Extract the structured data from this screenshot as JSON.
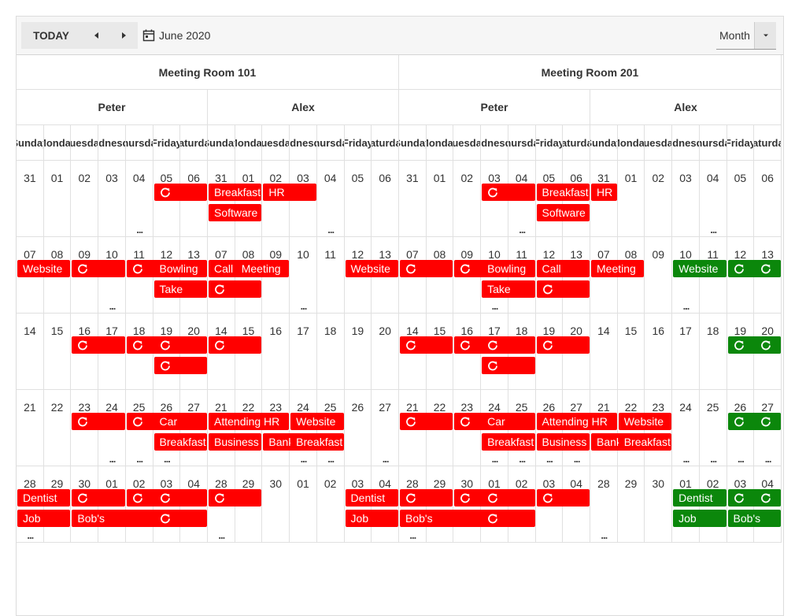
{
  "toolbar": {
    "today_label": "TODAY",
    "date_label": "June 2020",
    "view_label": "Month",
    "prev_icon": "triangle-left",
    "next_icon": "triangle-right",
    "calendar_icon": "calendar",
    "dropdown_icon": "triangle-down"
  },
  "rooms": [
    "Meeting Room 101",
    "Meeting Room 201"
  ],
  "employees": [
    "Peter",
    "Alex"
  ],
  "day_names": [
    "Sunday",
    "Monday",
    "Tuesday",
    "Wednesday",
    "Thursday",
    "Friday",
    "Saturday"
  ],
  "weeks": [
    [
      "31",
      "01",
      "02",
      "03",
      "04",
      "05",
      "06"
    ],
    [
      "07",
      "08",
      "09",
      "10",
      "11",
      "12",
      "13"
    ],
    [
      "14",
      "15",
      "16",
      "17",
      "18",
      "19",
      "20"
    ],
    [
      "21",
      "22",
      "23",
      "24",
      "25",
      "26",
      "27"
    ],
    [
      "28",
      "29",
      "30",
      "01",
      "02",
      "03",
      "04"
    ]
  ],
  "group_weeks": [
    [
      "31",
      "01",
      "02",
      "03",
      "04",
      "05",
      "06"
    ],
    [
      "07",
      "08",
      "09",
      "10",
      "11",
      "12",
      "13"
    ],
    [
      "14",
      "15",
      "16",
      "17",
      "18",
      "19",
      "20"
    ],
    [
      "21",
      "22",
      "23",
      "24",
      "25",
      "26",
      "27"
    ],
    [
      "28",
      "29",
      "30",
      "01",
      "02",
      "03",
      "04"
    ]
  ],
  "colors": {
    "red": "#ff0000",
    "green": "#0b870b"
  },
  "recurring_icon": "refresh-icon",
  "more_label": "...",
  "events": [
    {
      "g": 0,
      "w": 0,
      "s": 5,
      "span": 2,
      "r": 0,
      "text": "",
      "recurring": true,
      "color": "red"
    },
    {
      "g": 1,
      "w": 0,
      "s": 0,
      "span": 2,
      "r": 0,
      "text": "Breakfast",
      "recurring": false,
      "color": "red"
    },
    {
      "g": 1,
      "w": 0,
      "s": 2,
      "span": 2,
      "r": 0,
      "text": "HR",
      "recurring": false,
      "color": "red"
    },
    {
      "g": 1,
      "w": 0,
      "s": 0,
      "span": 2,
      "r": 1,
      "text": "Software",
      "recurring": false,
      "color": "red"
    },
    {
      "g": 2,
      "w": 0,
      "s": 3,
      "span": 2,
      "r": 0,
      "text": "",
      "recurring": true,
      "color": "red"
    },
    {
      "g": 2,
      "w": 0,
      "s": 5,
      "span": 2,
      "r": 0,
      "text": "Breakfast",
      "recurring": false,
      "color": "red"
    },
    {
      "g": 2,
      "w": 0,
      "s": 5,
      "span": 2,
      "r": 1,
      "text": "Software",
      "recurring": false,
      "color": "red"
    },
    {
      "g": 3,
      "w": 0,
      "s": 0,
      "span": 1,
      "r": 0,
      "text": "HR",
      "recurring": false,
      "color": "red"
    },
    {
      "g": 0,
      "w": 1,
      "s": 0,
      "span": 2,
      "r": 0,
      "text": "Website",
      "recurring": false,
      "color": "red"
    },
    {
      "g": 0,
      "w": 1,
      "s": 2,
      "span": 2,
      "r": 0,
      "text": "",
      "recurring": true,
      "color": "red"
    },
    {
      "g": 0,
      "w": 1,
      "s": 4,
      "span": 2,
      "r": 0,
      "text": "",
      "recurring": true,
      "color": "red"
    },
    {
      "g": 0,
      "w": 1,
      "s": 5,
      "span": 2,
      "r": 0,
      "text": "Bowling",
      "recurring": false,
      "color": "red"
    },
    {
      "g": 0,
      "w": 1,
      "s": 5,
      "span": 2,
      "r": 1,
      "text": "Take",
      "recurring": false,
      "color": "red"
    },
    {
      "g": 1,
      "w": 1,
      "s": 0,
      "span": 2,
      "r": 0,
      "text": "Call",
      "recurring": false,
      "color": "red"
    },
    {
      "g": 1,
      "w": 1,
      "s": 0,
      "span": 2,
      "r": 1,
      "text": "",
      "recurring": true,
      "color": "red"
    },
    {
      "g": 1,
      "w": 1,
      "s": 1,
      "span": 2,
      "r": 0,
      "text": "Meeting",
      "recurring": false,
      "color": "red"
    },
    {
      "g": 1,
      "w": 1,
      "s": 5,
      "span": 2,
      "r": 0,
      "text": "Website",
      "recurring": false,
      "color": "red"
    },
    {
      "g": 2,
      "w": 1,
      "s": 0,
      "span": 2,
      "r": 0,
      "text": "",
      "recurring": true,
      "color": "red"
    },
    {
      "g": 2,
      "w": 1,
      "s": 2,
      "span": 2,
      "r": 0,
      "text": "",
      "recurring": true,
      "color": "red"
    },
    {
      "g": 2,
      "w": 1,
      "s": 3,
      "span": 2,
      "r": 0,
      "text": "Bowling",
      "recurring": false,
      "color": "red"
    },
    {
      "g": 2,
      "w": 1,
      "s": 3,
      "span": 2,
      "r": 1,
      "text": "Take",
      "recurring": false,
      "color": "red"
    },
    {
      "g": 2,
      "w": 1,
      "s": 5,
      "span": 2,
      "r": 0,
      "text": "Call",
      "recurring": false,
      "color": "red"
    },
    {
      "g": 2,
      "w": 1,
      "s": 5,
      "span": 2,
      "r": 1,
      "text": "",
      "recurring": true,
      "color": "red"
    },
    {
      "g": 3,
      "w": 1,
      "s": 0,
      "span": 2,
      "r": 0,
      "text": "Meeting",
      "recurring": false,
      "color": "red"
    },
    {
      "g": 3,
      "w": 1,
      "s": 3,
      "span": 2,
      "r": 0,
      "text": "Website",
      "recurring": false,
      "color": "green"
    },
    {
      "g": 3,
      "w": 1,
      "s": 5,
      "span": 2,
      "r": 0,
      "text": "",
      "recurring": true,
      "color": "green"
    },
    {
      "g": 3,
      "w": 1,
      "s": 6,
      "span": 1,
      "r": 0,
      "text": "",
      "recurring": true,
      "color": "green"
    },
    {
      "g": 0,
      "w": 2,
      "s": 2,
      "span": 2,
      "r": 0,
      "text": "",
      "recurring": true,
      "color": "red"
    },
    {
      "g": 0,
      "w": 2,
      "s": 4,
      "span": 2,
      "r": 0,
      "text": "",
      "recurring": true,
      "color": "red"
    },
    {
      "g": 0,
      "w": 2,
      "s": 5,
      "span": 2,
      "r": 0,
      "text": "",
      "recurring": true,
      "color": "red"
    },
    {
      "g": 0,
      "w": 2,
      "s": 5,
      "span": 2,
      "r": 1,
      "text": "",
      "recurring": true,
      "color": "red"
    },
    {
      "g": 1,
      "w": 2,
      "s": 0,
      "span": 2,
      "r": 0,
      "text": "",
      "recurring": true,
      "color": "red"
    },
    {
      "g": 2,
      "w": 2,
      "s": 0,
      "span": 2,
      "r": 0,
      "text": "",
      "recurring": true,
      "color": "red"
    },
    {
      "g": 2,
      "w": 2,
      "s": 2,
      "span": 2,
      "r": 0,
      "text": "",
      "recurring": true,
      "color": "red"
    },
    {
      "g": 2,
      "w": 2,
      "s": 3,
      "span": 2,
      "r": 0,
      "text": "",
      "recurring": true,
      "color": "red"
    },
    {
      "g": 2,
      "w": 2,
      "s": 3,
      "span": 2,
      "r": 1,
      "text": "",
      "recurring": true,
      "color": "red"
    },
    {
      "g": 2,
      "w": 2,
      "s": 5,
      "span": 2,
      "r": 0,
      "text": "",
      "recurring": true,
      "color": "red"
    },
    {
      "g": 3,
      "w": 2,
      "s": 5,
      "span": 2,
      "r": 0,
      "text": "",
      "recurring": true,
      "color": "green"
    },
    {
      "g": 3,
      "w": 2,
      "s": 6,
      "span": 1,
      "r": 0,
      "text": "",
      "recurring": true,
      "color": "green"
    },
    {
      "g": 0,
      "w": 3,
      "s": 2,
      "span": 2,
      "r": 0,
      "text": "",
      "recurring": true,
      "color": "red"
    },
    {
      "g": 0,
      "w": 3,
      "s": 4,
      "span": 2,
      "r": 0,
      "text": "",
      "recurring": true,
      "color": "red"
    },
    {
      "g": 0,
      "w": 3,
      "s": 5,
      "span": 2,
      "r": 0,
      "text": "Car",
      "recurring": false,
      "color": "red"
    },
    {
      "g": 0,
      "w": 3,
      "s": 5,
      "span": 2,
      "r": 1,
      "text": "Breakfast",
      "recurring": false,
      "color": "red"
    },
    {
      "g": 1,
      "w": 3,
      "s": 0,
      "span": 3,
      "r": 0,
      "text": "Attending HR",
      "recurring": false,
      "color": "red"
    },
    {
      "g": 1,
      "w": 3,
      "s": 0,
      "span": 2,
      "r": 1,
      "text": "Business",
      "recurring": false,
      "color": "red"
    },
    {
      "g": 1,
      "w": 3,
      "s": 2,
      "span": 2,
      "r": 1,
      "text": "Banking",
      "recurring": false,
      "color": "red"
    },
    {
      "g": 1,
      "w": 3,
      "s": 3,
      "span": 2,
      "r": 0,
      "text": "Website",
      "recurring": false,
      "color": "red"
    },
    {
      "g": 1,
      "w": 3,
      "s": 3,
      "span": 2,
      "r": 1,
      "text": "Breakfast",
      "recurring": false,
      "color": "red"
    },
    {
      "g": 2,
      "w": 3,
      "s": 0,
      "span": 2,
      "r": 0,
      "text": "",
      "recurring": true,
      "color": "red"
    },
    {
      "g": 2,
      "w": 3,
      "s": 2,
      "span": 2,
      "r": 0,
      "text": "",
      "recurring": true,
      "color": "red"
    },
    {
      "g": 2,
      "w": 3,
      "s": 3,
      "span": 2,
      "r": 0,
      "text": "Car",
      "recurring": false,
      "color": "red"
    },
    {
      "g": 2,
      "w": 3,
      "s": 3,
      "span": 2,
      "r": 1,
      "text": "Breakfast",
      "recurring": false,
      "color": "red"
    },
    {
      "g": 2,
      "w": 3,
      "s": 5,
      "span": 3,
      "r": 0,
      "text": "Attending HR",
      "recurring": false,
      "color": "red"
    },
    {
      "g": 2,
      "w": 3,
      "s": 5,
      "span": 2,
      "r": 1,
      "text": "Business",
      "recurring": false,
      "color": "red"
    },
    {
      "g": 3,
      "w": 3,
      "s": 0,
      "span": 2,
      "r": 1,
      "text": "Banking",
      "recurring": false,
      "color": "red"
    },
    {
      "g": 3,
      "w": 3,
      "s": 1,
      "span": 2,
      "r": 0,
      "text": "Website",
      "recurring": false,
      "color": "red"
    },
    {
      "g": 3,
      "w": 3,
      "s": 1,
      "span": 2,
      "r": 1,
      "text": "Breakfast",
      "recurring": false,
      "color": "red"
    },
    {
      "g": 3,
      "w": 3,
      "s": 5,
      "span": 2,
      "r": 0,
      "text": "",
      "recurring": true,
      "color": "green"
    },
    {
      "g": 3,
      "w": 3,
      "s": 6,
      "span": 1,
      "r": 0,
      "text": "",
      "recurring": true,
      "color": "green"
    },
    {
      "g": 0,
      "w": 4,
      "s": 0,
      "span": 2,
      "r": 0,
      "text": "Dentist",
      "recurring": false,
      "color": "red"
    },
    {
      "g": 0,
      "w": 4,
      "s": 0,
      "span": 2,
      "r": 1,
      "text": "Job",
      "recurring": false,
      "color": "red"
    },
    {
      "g": 0,
      "w": 4,
      "s": 2,
      "span": 2,
      "r": 0,
      "text": "",
      "recurring": true,
      "color": "red"
    },
    {
      "g": 0,
      "w": 4,
      "s": 2,
      "span": 4,
      "r": 1,
      "text": "Bob's",
      "recurring": false,
      "color": "red"
    },
    {
      "g": 0,
      "w": 4,
      "s": 4,
      "span": 2,
      "r": 0,
      "text": "",
      "recurring": true,
      "color": "red"
    },
    {
      "g": 0,
      "w": 4,
      "s": 5,
      "span": 2,
      "r": 0,
      "text": "",
      "recurring": true,
      "color": "red"
    },
    {
      "g": 0,
      "w": 4,
      "s": 5,
      "span": 2,
      "r": 1,
      "text": "",
      "recurring": true,
      "color": "red"
    },
    {
      "g": 1,
      "w": 4,
      "s": 0,
      "span": 2,
      "r": 0,
      "text": "",
      "recurring": true,
      "color": "red"
    },
    {
      "g": 1,
      "w": 4,
      "s": 5,
      "span": 2,
      "r": 0,
      "text": "Dentist",
      "recurring": false,
      "color": "red"
    },
    {
      "g": 1,
      "w": 4,
      "s": 5,
      "span": 2,
      "r": 1,
      "text": "Job",
      "recurring": false,
      "color": "red"
    },
    {
      "g": 2,
      "w": 4,
      "s": 0,
      "span": 2,
      "r": 0,
      "text": "",
      "recurring": true,
      "color": "red"
    },
    {
      "g": 2,
      "w": 4,
      "s": 0,
      "span": 4,
      "r": 1,
      "text": "Bob's",
      "recurring": false,
      "color": "red"
    },
    {
      "g": 2,
      "w": 4,
      "s": 2,
      "span": 2,
      "r": 0,
      "text": "",
      "recurring": true,
      "color": "red"
    },
    {
      "g": 2,
      "w": 4,
      "s": 3,
      "span": 2,
      "r": 0,
      "text": "",
      "recurring": true,
      "color": "red"
    },
    {
      "g": 2,
      "w": 4,
      "s": 3,
      "span": 2,
      "r": 1,
      "text": "",
      "recurring": true,
      "color": "red"
    },
    {
      "g": 2,
      "w": 4,
      "s": 5,
      "span": 2,
      "r": 0,
      "text": "",
      "recurring": true,
      "color": "red"
    },
    {
      "g": 3,
      "w": 4,
      "s": 3,
      "span": 2,
      "r": 0,
      "text": "Dentist",
      "recurring": false,
      "color": "green"
    },
    {
      "g": 3,
      "w": 4,
      "s": 3,
      "span": 2,
      "r": 1,
      "text": "Job",
      "recurring": false,
      "color": "green"
    },
    {
      "g": 3,
      "w": 4,
      "s": 5,
      "span": 2,
      "r": 0,
      "text": "",
      "recurring": true,
      "color": "green"
    },
    {
      "g": 3,
      "w": 4,
      "s": 5,
      "span": 2,
      "r": 1,
      "text": "Bob's",
      "recurring": false,
      "color": "green"
    },
    {
      "g": 3,
      "w": 4,
      "s": 6,
      "span": 1,
      "r": 0,
      "text": "",
      "recurring": true,
      "color": "green"
    }
  ],
  "more_markers": [
    {
      "g": 0,
      "w": 0,
      "s": 4
    },
    {
      "g": 1,
      "w": 0,
      "s": 4
    },
    {
      "g": 2,
      "w": 0,
      "s": 4
    },
    {
      "g": 3,
      "w": 0,
      "s": 4
    },
    {
      "g": 0,
      "w": 1,
      "s": 3
    },
    {
      "g": 1,
      "w": 1,
      "s": 3
    },
    {
      "g": 2,
      "w": 1,
      "s": 3
    },
    {
      "g": 3,
      "w": 1,
      "s": 3
    },
    {
      "g": 0,
      "w": 3,
      "s": 3
    },
    {
      "g": 0,
      "w": 3,
      "s": 4
    },
    {
      "g": 0,
      "w": 3,
      "s": 5
    },
    {
      "g": 1,
      "w": 3,
      "s": 3
    },
    {
      "g": 1,
      "w": 3,
      "s": 4
    },
    {
      "g": 1,
      "w": 3,
      "s": 6
    },
    {
      "g": 2,
      "w": 3,
      "s": 3
    },
    {
      "g": 2,
      "w": 3,
      "s": 4
    },
    {
      "g": 2,
      "w": 3,
      "s": 5
    },
    {
      "g": 2,
      "w": 3,
      "s": 6
    },
    {
      "g": 3,
      "w": 3,
      "s": 3
    },
    {
      "g": 3,
      "w": 3,
      "s": 4
    },
    {
      "g": 3,
      "w": 3,
      "s": 5
    },
    {
      "g": 3,
      "w": 3,
      "s": 6
    },
    {
      "g": 0,
      "w": 4,
      "s": 0
    },
    {
      "g": 1,
      "w": 4,
      "s": 0
    },
    {
      "g": 2,
      "w": 4,
      "s": 0
    },
    {
      "g": 3,
      "w": 4,
      "s": 0
    }
  ]
}
